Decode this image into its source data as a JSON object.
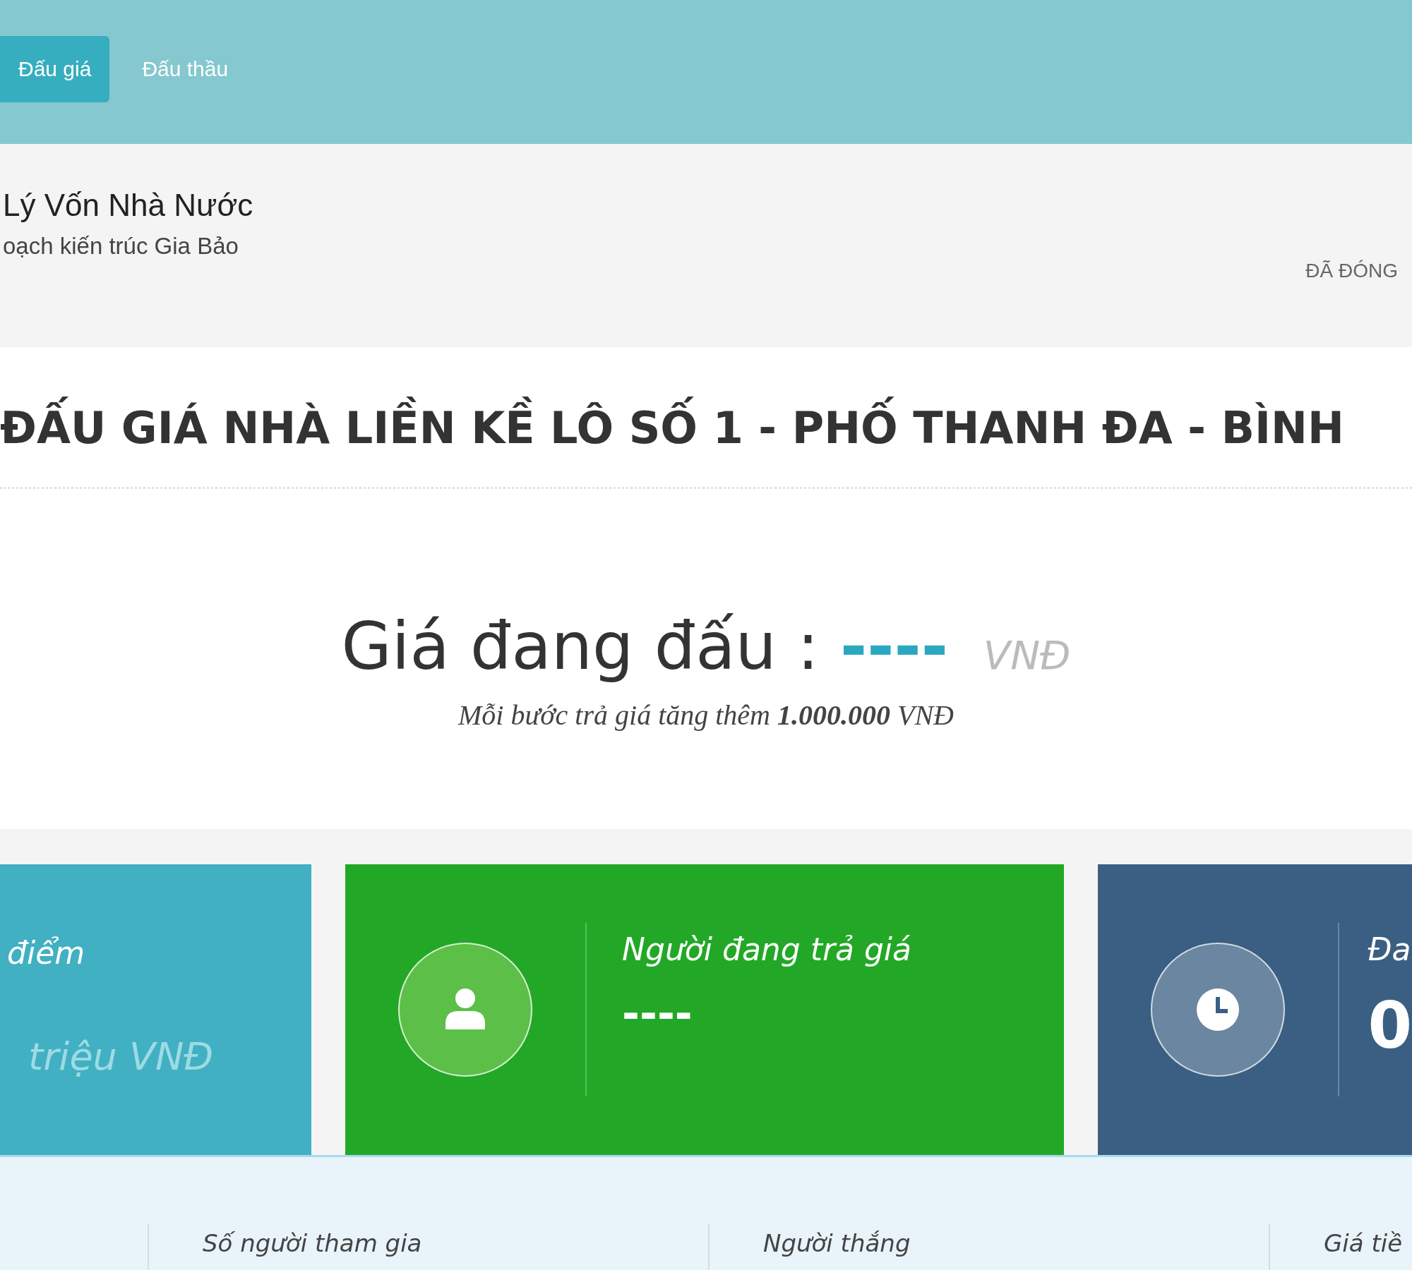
{
  "tabs": [
    {
      "label": "Đấu giá",
      "selected": true
    },
    {
      "label": "Đấu thầu",
      "selected": false
    }
  ],
  "organization": {
    "name": "Lý Vốn Nhà Nước",
    "subtitle": "oạch kiến trúc Gia Bảo",
    "status": "ĐÃ ĐÓNG"
  },
  "auction": {
    "title": "ĐẤU GIÁ NHÀ LIỀN KỀ LÔ SỐ 1 - PHỐ THANH ĐA - BÌNH",
    "price_label": "Giá đang đấu :",
    "price_value": "----",
    "price_unit": "VNĐ",
    "step_note": "Mỗi bước trả giá tăng thêm **1.000.000** VNĐ"
  },
  "cards": [
    {
      "kind": "info",
      "color": "#41b0c2",
      "label": "điểm",
      "value": "triệu VNĐ"
    },
    {
      "kind": "bidder",
      "color": "#22a826",
      "label": "Người đang trả giá",
      "value": "----"
    },
    {
      "kind": "time",
      "color": "#3b5f82",
      "label": "Đa",
      "value": "0"
    }
  ],
  "summary": {
    "columns": [
      "Số người tham gia",
      "Người thắng",
      "Giá tiề"
    ]
  }
}
